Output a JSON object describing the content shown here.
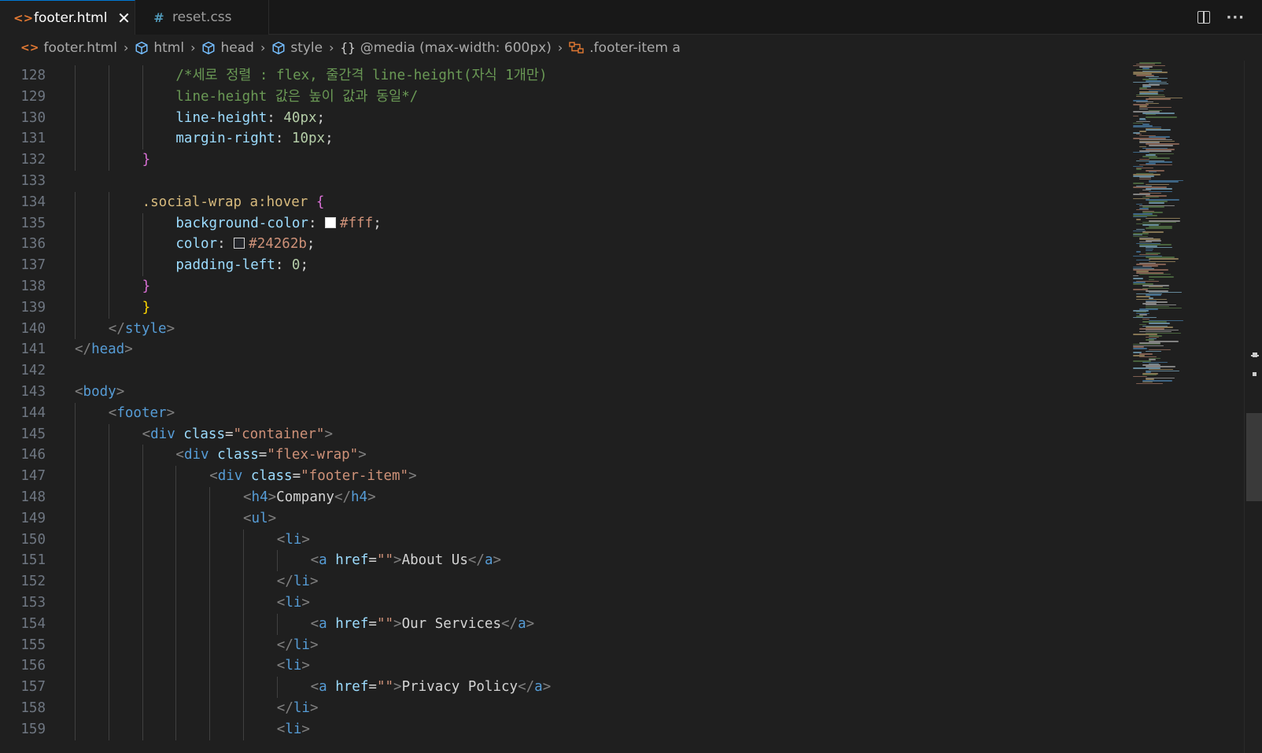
{
  "tabs": [
    {
      "label": "footer.html",
      "icon": "html-file-icon",
      "active": true
    },
    {
      "label": "reset.css",
      "icon": "css-file-icon",
      "active": false
    }
  ],
  "tab_icons": {
    "html": "<>",
    "css": "#",
    "close": "✕",
    "more": "···"
  },
  "breadcrumb": [
    {
      "label": "footer.html",
      "icon": "html-file-icon"
    },
    {
      "label": "html",
      "icon": "element-icon"
    },
    {
      "label": "head",
      "icon": "element-icon"
    },
    {
      "label": "style",
      "icon": "element-icon"
    },
    {
      "label": "@media (max-width: 600px)",
      "icon": "braces-icon",
      "icon_text": "{}"
    },
    {
      "label": ".footer-item a",
      "icon": "selector-icon"
    }
  ],
  "editor": {
    "line_numbers": [
      "128",
      "129",
      "130",
      "131",
      "132",
      "133",
      "134",
      "135",
      "136",
      "137",
      "138",
      "139",
      "140",
      "141",
      "142",
      "143",
      "144",
      "145",
      "146",
      "147",
      "148",
      "149",
      "150",
      "151",
      "152",
      "153",
      "154",
      "155",
      "156",
      "157",
      "158",
      "159"
    ],
    "lines": [
      [
        "/*세로 정렬 : flex, 줄간격 line-height(자식 1개만)"
      ],
      [
        "line-height 값은 높이 값과 동일*/"
      ],
      [
        "line-height",
        ": ",
        "40px",
        ";"
      ],
      [
        "margin-right",
        ": ",
        "10px",
        ";"
      ],
      [
        "}"
      ],
      [],
      [
        ".social-wrap a:hover",
        " ",
        "{"
      ],
      [
        "background-color",
        ": ",
        "#fff",
        ";"
      ],
      [
        "color",
        ": ",
        "#24262b",
        ";"
      ],
      [
        "padding-left",
        ": ",
        "0",
        ";"
      ],
      [
        "}"
      ],
      [
        "}"
      ],
      [
        "</",
        "style",
        ">"
      ],
      [
        "</",
        "head",
        ">"
      ],
      [],
      [
        "<",
        "body",
        ">"
      ],
      [
        "<",
        "footer",
        ">"
      ],
      [
        "<",
        "div",
        " ",
        "class",
        "=",
        "\"container\"",
        ">"
      ],
      [
        "<",
        "div",
        " ",
        "class",
        "=",
        "\"flex-wrap\"",
        ">"
      ],
      [
        "<",
        "div",
        " ",
        "class",
        "=",
        "\"footer-item\"",
        ">"
      ],
      [
        "<",
        "h4",
        ">",
        "Company",
        "</",
        "h4",
        ">"
      ],
      [
        "<",
        "ul",
        ">"
      ],
      [
        "<",
        "li",
        ">"
      ],
      [
        "<",
        "a",
        " ",
        "href",
        "=",
        "\"\"",
        ">",
        "About Us",
        "</",
        "a",
        ">"
      ],
      [
        "</",
        "li",
        ">"
      ],
      [
        "<",
        "li",
        ">"
      ],
      [
        "<",
        "a",
        " ",
        "href",
        "=",
        "\"\"",
        ">",
        "Our Services",
        "</",
        "a",
        ">"
      ],
      [
        "</",
        "li",
        ">"
      ],
      [
        "<",
        "li",
        ">"
      ],
      [
        "<",
        "a",
        " ",
        "href",
        "=",
        "\"\"",
        ">",
        "Privacy Policy",
        "</",
        "a",
        ">"
      ],
      [
        "</",
        "li",
        ">"
      ],
      [
        "<",
        "li",
        ">"
      ]
    ]
  },
  "colors": {
    "background": "#1f1f1f",
    "tabbar": "#181818",
    "accent": "#0078d4",
    "swatch_white": "#fff",
    "swatch_dark": "#24262b"
  }
}
